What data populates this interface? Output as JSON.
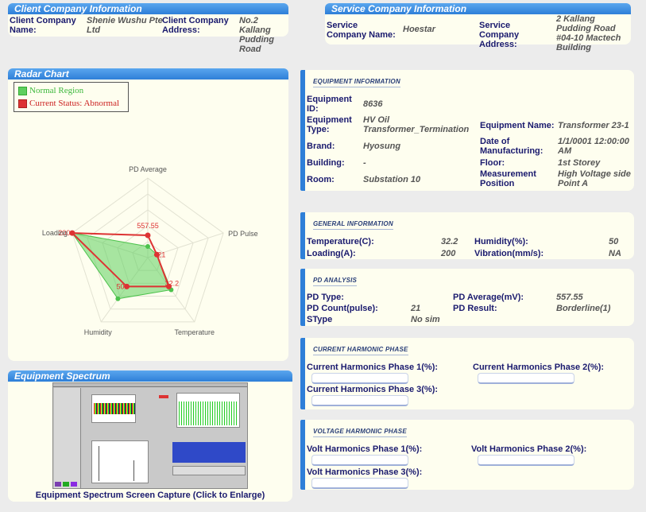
{
  "client": {
    "header": "Client Company Information",
    "name_label": "Client Company Name:",
    "name_value": "Shenie Wushu Pte Ltd",
    "address_label": "Client Company Address:",
    "address_value": "No.2 Kallang Pudding Road"
  },
  "service": {
    "header": "Service Company Information",
    "name_label": "Service Company Name:",
    "name_value": "Hoestar",
    "address_label": "Service Company Address:",
    "address_value": "2 Kallang Pudding Road #04-10 Mactech Building"
  },
  "radar": {
    "header": "Radar Chart",
    "legend_normal": "Normal Region",
    "legend_current": "Current Status: Abnormal"
  },
  "chart_data": {
    "type": "radar",
    "axes": [
      "PD Average",
      "PD Pulse",
      "Temperature",
      "Humidity",
      "Loading"
    ],
    "series": [
      {
        "name": "Normal Region",
        "values": [
          0.14,
          0.12,
          0.5,
          0.64,
          1.0
        ]
      },
      {
        "name": "Current Status: Abnormal",
        "values": [
          0.28,
          0.12,
          0.45,
          0.45,
          1.0
        ]
      }
    ],
    "data_labels": [
      "557.55",
      "21",
      "32.2",
      "50",
      "200"
    ],
    "colors": {
      "normal": "#5fcf5f",
      "current": "#dd3333",
      "grid": "#e2e2d2"
    }
  },
  "spectrum": {
    "header": "Equipment Spectrum",
    "caption": "Equipment Spectrum Screen Capture (Click to Enlarge)"
  },
  "equipment": {
    "title": "EQUIPMENT INFORMATION",
    "id_label": "Equipment ID:",
    "id_value": "8636",
    "type_label": "Equipment Type:",
    "type_value": "HV Oil Transformer_Termination",
    "name_label": "Equipment Name:",
    "name_value": "Transformer 23-1",
    "brand_label": "Brand:",
    "brand_value": "Hyosung",
    "mfg_label": "Date of Manufacturing:",
    "mfg_value": "1/1/0001 12:00:00 AM",
    "building_label": "Building:",
    "building_value": "-",
    "floor_label": "Floor:",
    "floor_value": "1st Storey",
    "room_label": "Room:",
    "room_value": "Substation 10",
    "position_label": "Measurement Position",
    "position_value": "High Voltage side Point A"
  },
  "general": {
    "title": "GENERAL INFORMATION",
    "temp_label": "Temperature(C):",
    "temp_value": "32.2",
    "humidity_label": "Humidity(%):",
    "humidity_value": "50",
    "loading_label": "Loading(A):",
    "loading_value": "200",
    "vibration_label": "Vibration(mm/s):",
    "vibration_value": "NA"
  },
  "pd": {
    "title": "PD ANALYSIS",
    "type_label": "PD Type:",
    "type_value": "",
    "avg_label": "PD Average(mV):",
    "avg_value": "557.55",
    "count_label": "PD Count(pulse):",
    "count_value": "21",
    "result_label": "PD Result:",
    "result_value": "Borderline(1)",
    "stype_label": "SType",
    "stype_value": "No sim"
  },
  "current_harmonic": {
    "title": "CURRENT HARMONIC PHASE",
    "p1_label": "Current Harmonics Phase 1(%):",
    "p2_label": "Current Harmonics Phase 2(%):",
    "p3_label": "Current Harmonics Phase 3(%):"
  },
  "voltage_harmonic": {
    "title": "VOLTAGE HARMONIC PHASE",
    "p1_label": "Volt Harmonics Phase 1(%):",
    "p2_label": "Volt Harmonics Phase 2(%):",
    "p3_label": "Volt Harmonics Phase 3(%):"
  }
}
